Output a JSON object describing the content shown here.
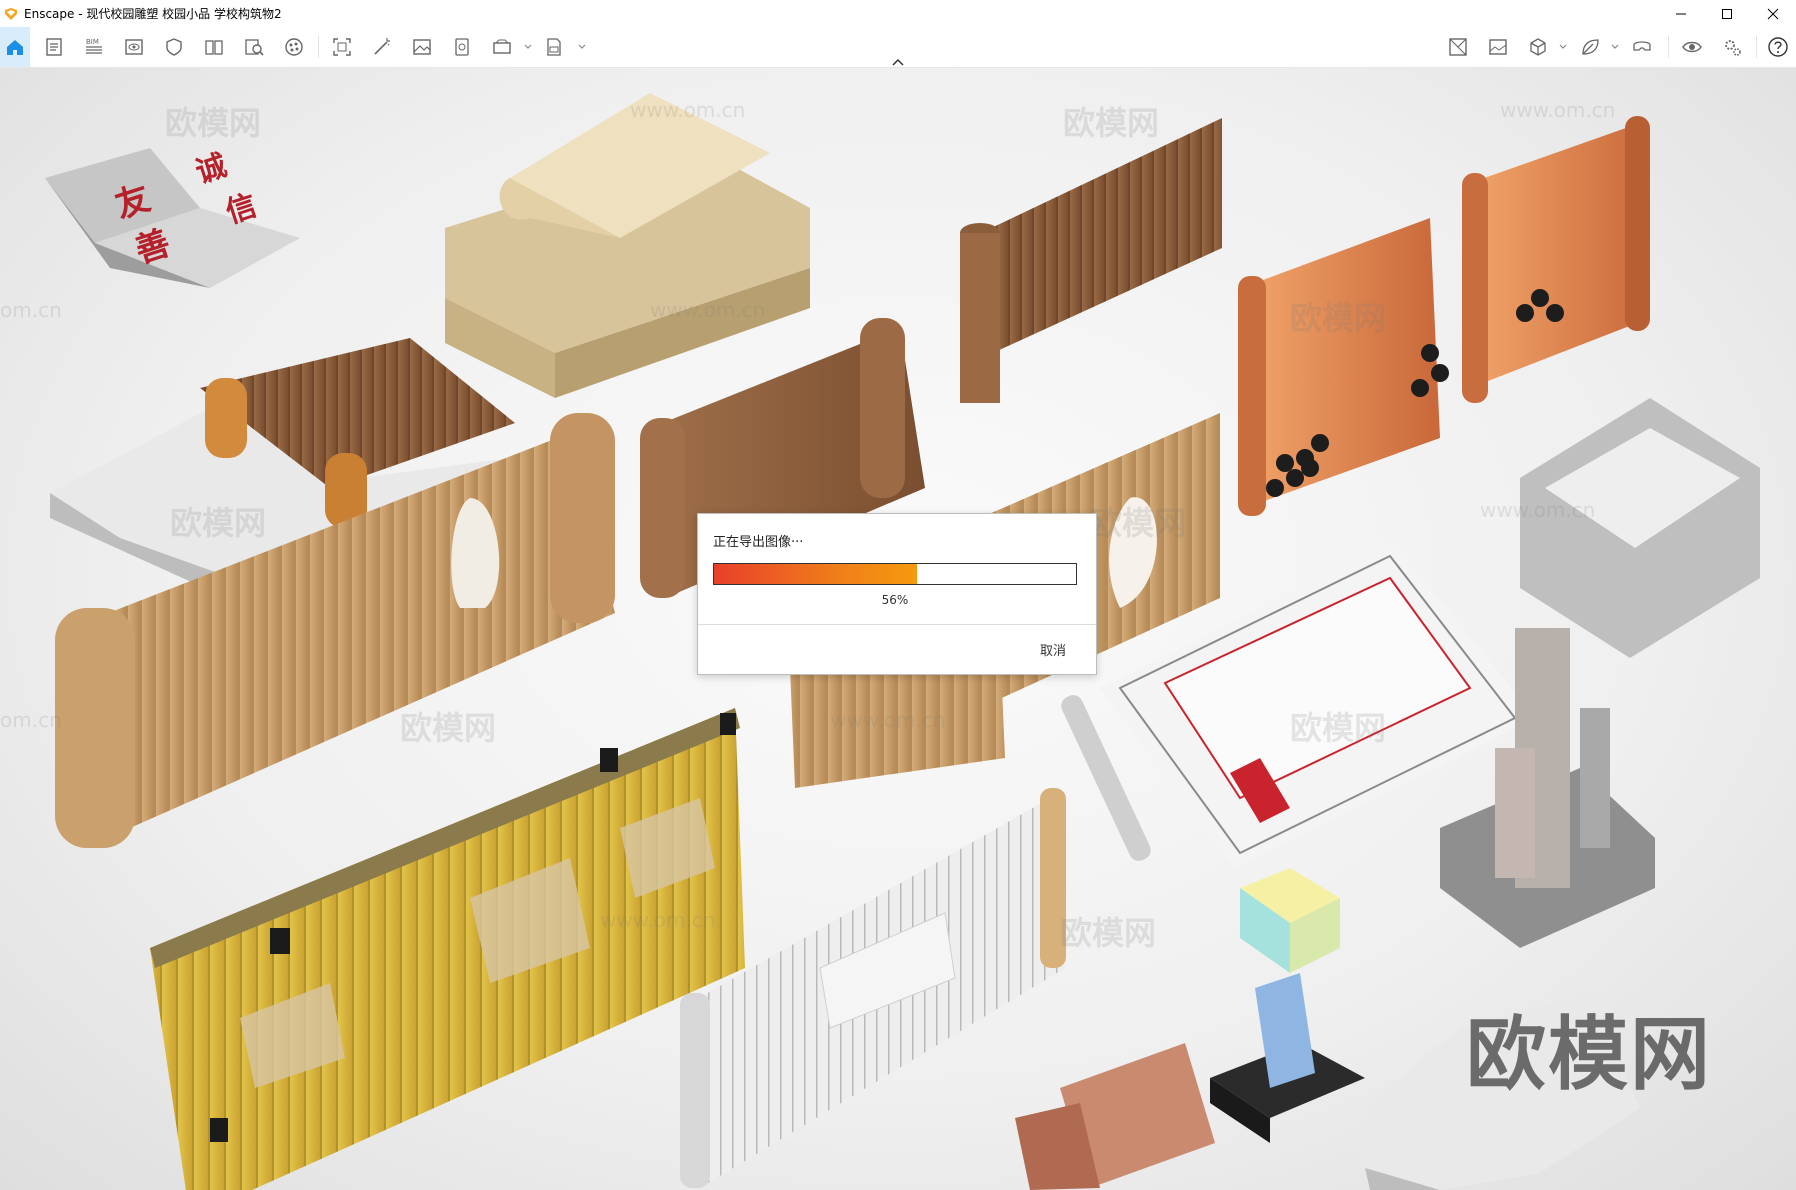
{
  "window": {
    "app_name": "Enscape",
    "title": "Enscape - 现代校园雕塑 校园小品 学校构筑物2",
    "brand_color": "#f5a623"
  },
  "toolbar": {
    "left_icons": [
      "home-icon",
      "document-icon",
      "bim-icon",
      "view-icon",
      "asset-icon",
      "library-icon",
      "search-doc-icon",
      "material-icon",
      "screenshot-icon",
      "magic-icon",
      "image-icon",
      "batch-icon",
      "video-icon",
      "export-icon"
    ],
    "right_icons": [
      "capture-icon",
      "gallery-icon",
      "cube-icon",
      "leaf-icon",
      "vr-icon",
      "eye-icon",
      "settings-icon",
      "help-icon"
    ],
    "bim_label": "BIM",
    "accent_color": "#1a8fe3"
  },
  "dialog": {
    "title": "正在导出图像···",
    "progress": 0.56,
    "progress_text": "56%",
    "cancel_label": "取消"
  },
  "watermarks": {
    "brand": "欧模网",
    "url": "www.om.cn",
    "domain_fragment": "om.cn"
  }
}
